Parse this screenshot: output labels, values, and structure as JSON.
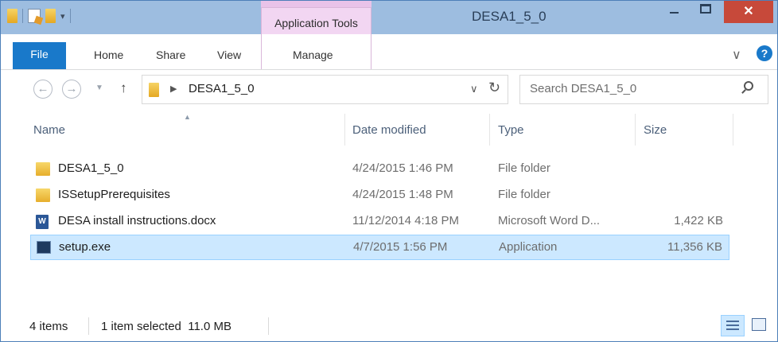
{
  "window": {
    "title": "DESA1_5_0",
    "context_tab_group": "Application Tools",
    "close_glyph": "✕"
  },
  "ribbon": {
    "tabs": [
      "File",
      "Home",
      "Share",
      "View",
      "Manage"
    ],
    "help_glyph": "?",
    "collapse_glyph": "∨"
  },
  "address": {
    "path": "DESA1_5_0",
    "search_placeholder": "Search DESA1_5_0"
  },
  "columns": [
    "Name",
    "Date modified",
    "Type",
    "Size"
  ],
  "files": [
    {
      "name": "DESA1_5_0",
      "date": "4/24/2015 1:46 PM",
      "type": "File folder",
      "size": "",
      "icon": "folder-icon"
    },
    {
      "name": "ISSetupPrerequisites",
      "date": "4/24/2015 1:48 PM",
      "type": "File folder",
      "size": "",
      "icon": "folder-icon"
    },
    {
      "name": "DESA install instructions.docx",
      "date": "11/12/2014 4:18 PM",
      "type": "Microsoft Word D...",
      "size": "1,422 KB",
      "icon": "word-document-icon"
    },
    {
      "name": "setup.exe",
      "date": "4/7/2015 1:56 PM",
      "type": "Application",
      "size": "11,356 KB",
      "icon": "application-icon",
      "selected": true
    }
  ],
  "status": {
    "item_count": "4 items",
    "selection": "1 item selected  11.0 MB"
  },
  "colors": {
    "title_bar": "#9dbde0",
    "file_tab": "#1979ca",
    "context_tab": "#f2d6f2",
    "close_button": "#c7493a",
    "selection": "#cce8ff"
  }
}
